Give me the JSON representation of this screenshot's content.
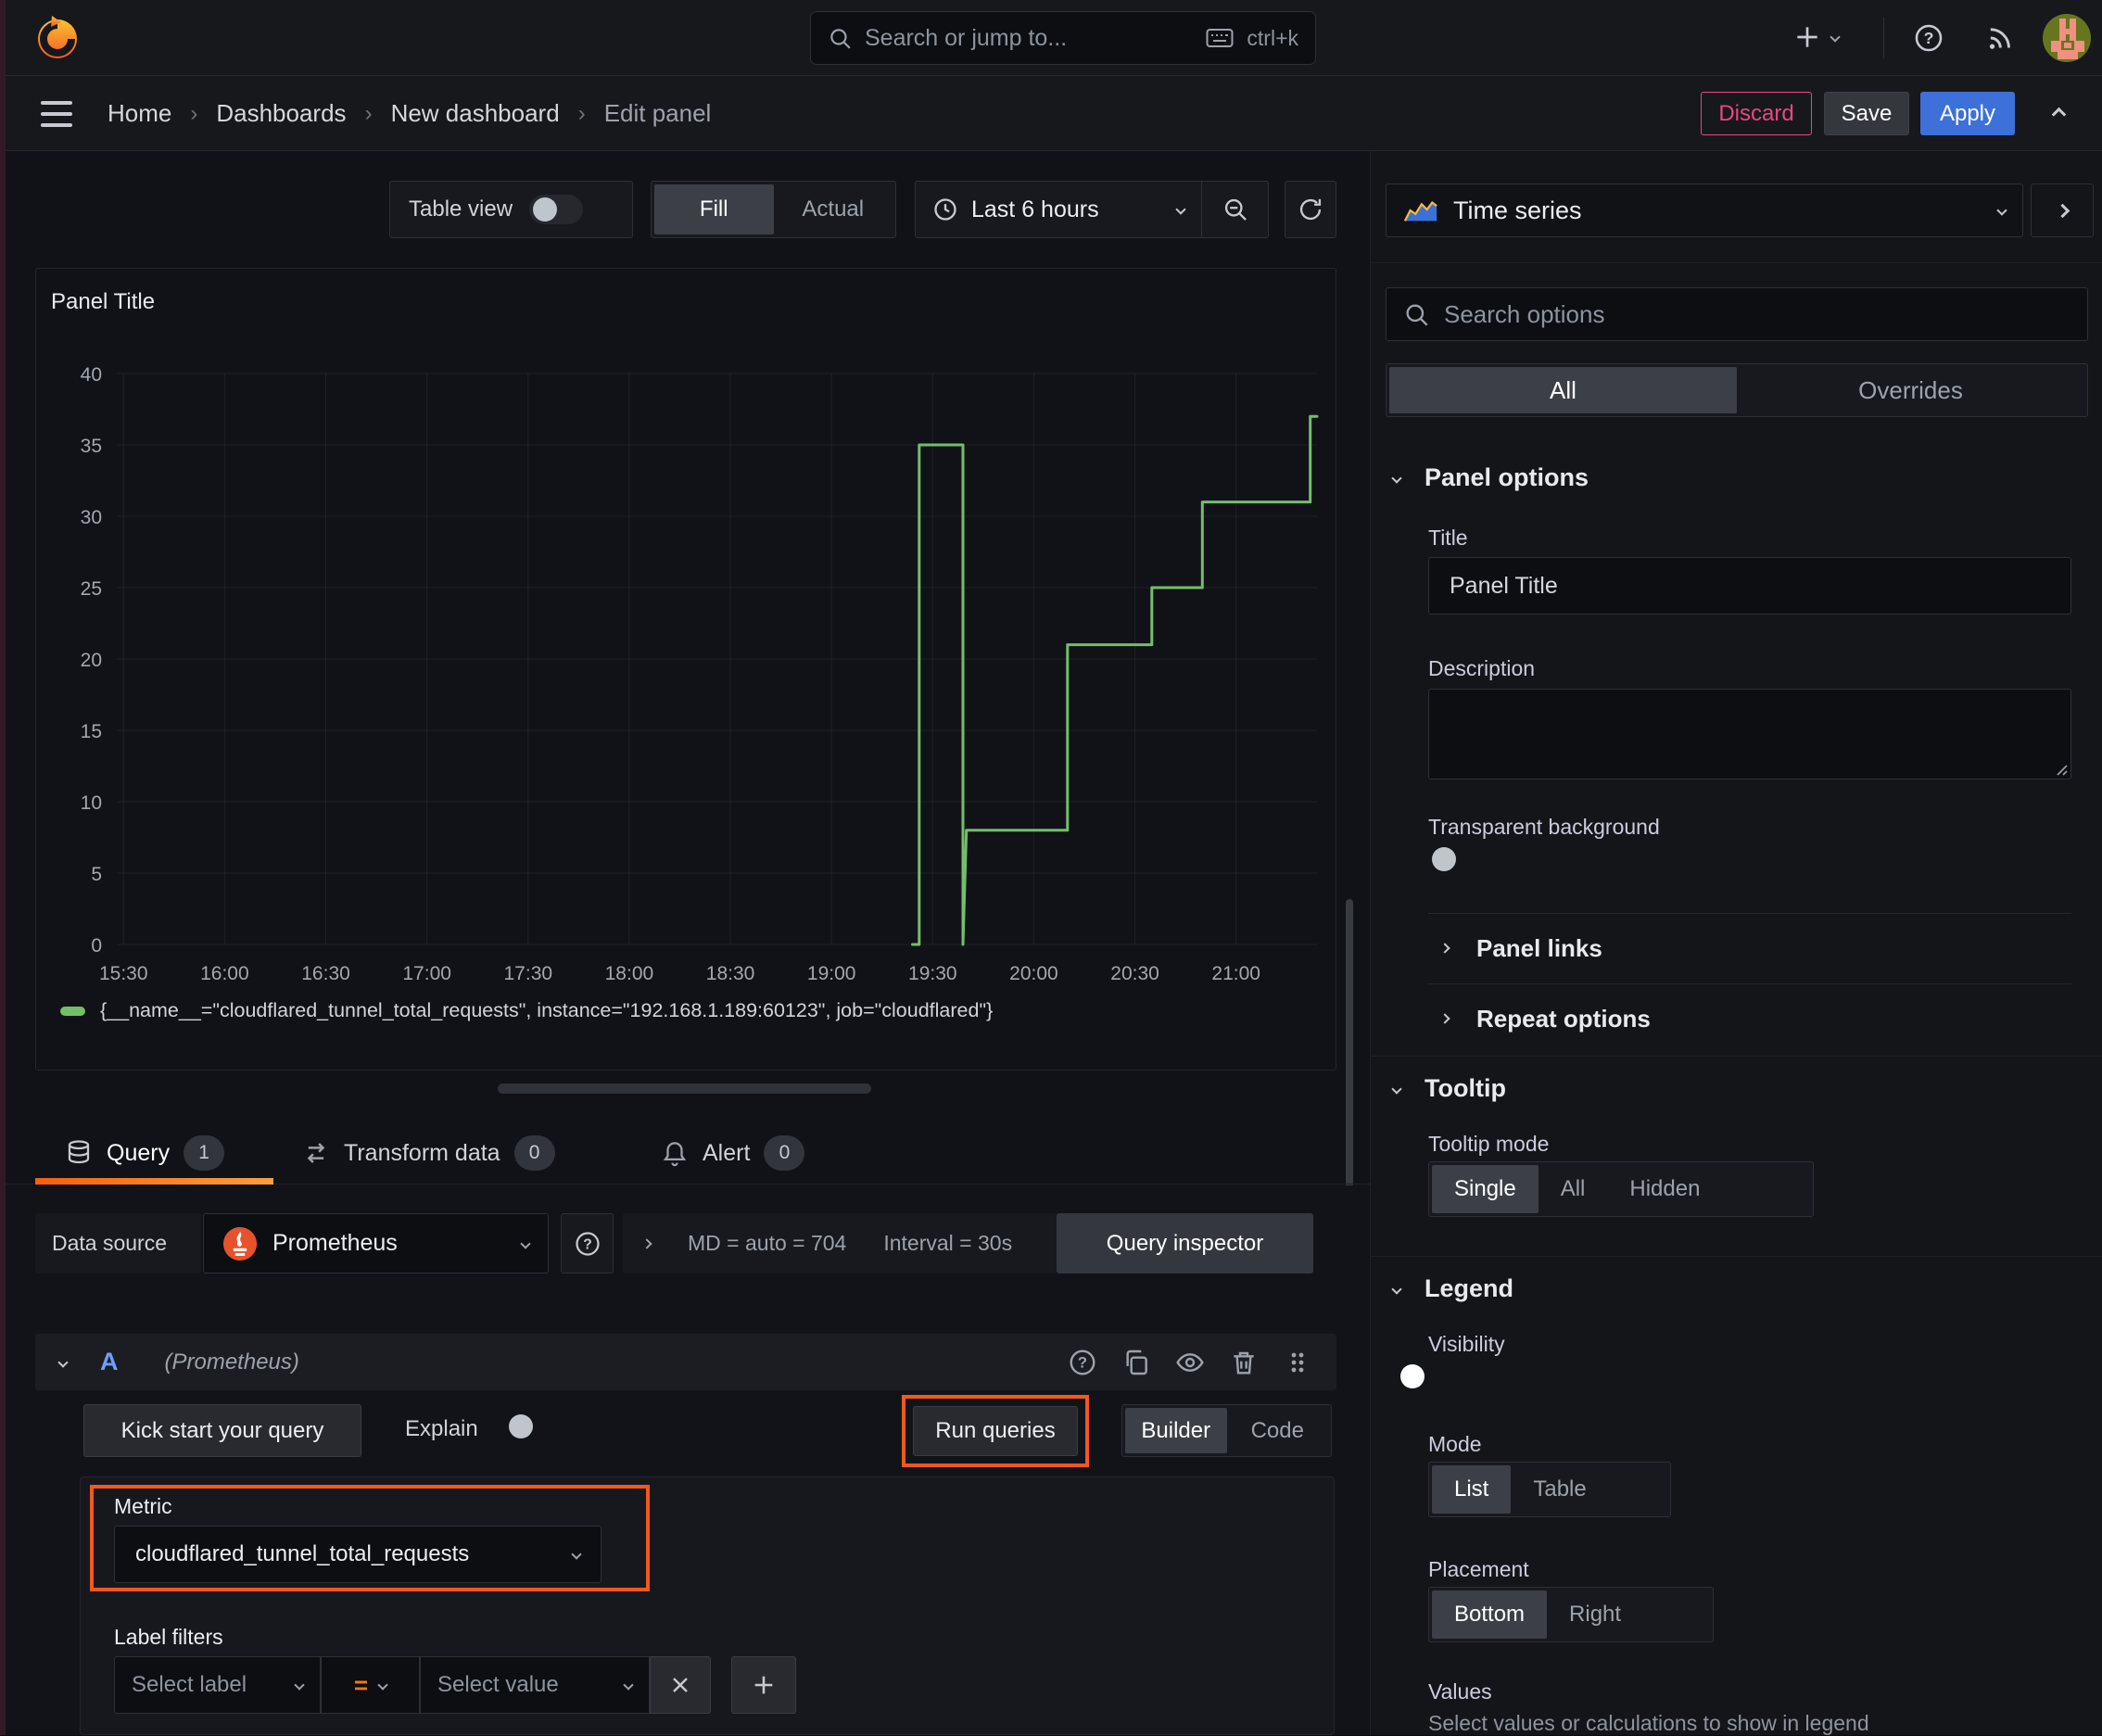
{
  "topbar": {
    "search_placeholder": "Search or jump to...",
    "shortcut": "ctrl+k"
  },
  "breadcrumb": {
    "items": [
      "Home",
      "Dashboards",
      "New dashboard",
      "Edit panel"
    ],
    "discard_label": "Discard",
    "save_label": "Save",
    "apply_label": "Apply"
  },
  "toolbar": {
    "table_view_label": "Table view",
    "fill_label": "Fill",
    "actual_label": "Actual",
    "time_range_label": "Last 6 hours"
  },
  "panel": {
    "title": "Panel Title"
  },
  "chart_data": {
    "type": "line",
    "title": "Panel Title",
    "x_ticks": [
      "15:30",
      "16:00",
      "16:30",
      "17:00",
      "17:30",
      "18:00",
      "18:30",
      "19:00",
      "19:30",
      "20:00",
      "20:30",
      "21:00"
    ],
    "x_domain": [
      "15:28",
      "21:24"
    ],
    "y_ticks": [
      0,
      5,
      10,
      15,
      20,
      25,
      30,
      35,
      40
    ],
    "ylim": [
      0,
      40
    ],
    "grid": true,
    "legend_position": "bottom",
    "series": [
      {
        "name": "{__name__=\"cloudflared_tunnel_total_requests\", instance=\"192.168.1.189:60123\", job=\"cloudflared\"}",
        "color": "#73bf69",
        "points": [
          [
            "19:24",
            0
          ],
          [
            "19:26",
            0
          ],
          [
            "19:26",
            35
          ],
          [
            "19:39",
            35
          ],
          [
            "19:39",
            0
          ],
          [
            "19:40",
            8
          ],
          [
            "20:10",
            8
          ],
          [
            "20:10",
            21
          ],
          [
            "20:35",
            21
          ],
          [
            "20:35",
            25
          ],
          [
            "20:50",
            25
          ],
          [
            "20:50",
            31
          ],
          [
            "21:22",
            31
          ],
          [
            "21:22",
            37
          ],
          [
            "21:24",
            37
          ]
        ]
      }
    ]
  },
  "tabs": {
    "query_label": "Query",
    "query_count": "1",
    "transform_label": "Transform data",
    "transform_count": "0",
    "alert_label": "Alert",
    "alert_count": "0"
  },
  "query": {
    "data_source_label": "Data source",
    "data_source_value": "Prometheus",
    "max_data_points": "MD = auto = 704",
    "interval": "Interval = 30s",
    "inspector_label": "Query inspector",
    "ref_id": "A",
    "ref_ds": "(Prometheus)",
    "kick_start_label": "Kick start your query",
    "explain_label": "Explain",
    "run_queries_label": "Run queries",
    "builder_label": "Builder",
    "code_label": "Code",
    "metric_label": "Metric",
    "metric_value": "cloudflared_tunnel_total_requests",
    "label_filters_label": "Label filters",
    "select_label_placeholder": "Select label",
    "operator": "=",
    "select_value_placeholder": "Select value"
  },
  "options": {
    "visualization": "Time series",
    "search_placeholder": "Search options",
    "tab_all": "All",
    "tab_overrides": "Overrides",
    "panel_options": {
      "header": "Panel options",
      "title_label": "Title",
      "title_value": "Panel Title",
      "description_label": "Description",
      "description_value": "",
      "transparent_label": "Transparent background",
      "panel_links_label": "Panel links",
      "repeat_options_label": "Repeat options"
    },
    "tooltip": {
      "header": "Tooltip",
      "mode_label": "Tooltip mode",
      "modes": [
        "Single",
        "All",
        "Hidden"
      ],
      "selected": "Single"
    },
    "legend": {
      "header": "Legend",
      "visibility_label": "Visibility",
      "mode_label": "Mode",
      "modes": [
        "List",
        "Table"
      ],
      "mode_selected": "List",
      "placement_label": "Placement",
      "placements": [
        "Bottom",
        "Right"
      ],
      "placement_selected": "Bottom",
      "values_label": "Values",
      "values_hint": "Select values or calculations to show in legend"
    }
  },
  "colors": {
    "accent_orange": "#f4581c",
    "tab_underline": "#ff6c12",
    "blue": "#3d71d9",
    "green": "#73bf69",
    "pink": "#e8487f",
    "prometheus_orange": "#e6522c"
  }
}
